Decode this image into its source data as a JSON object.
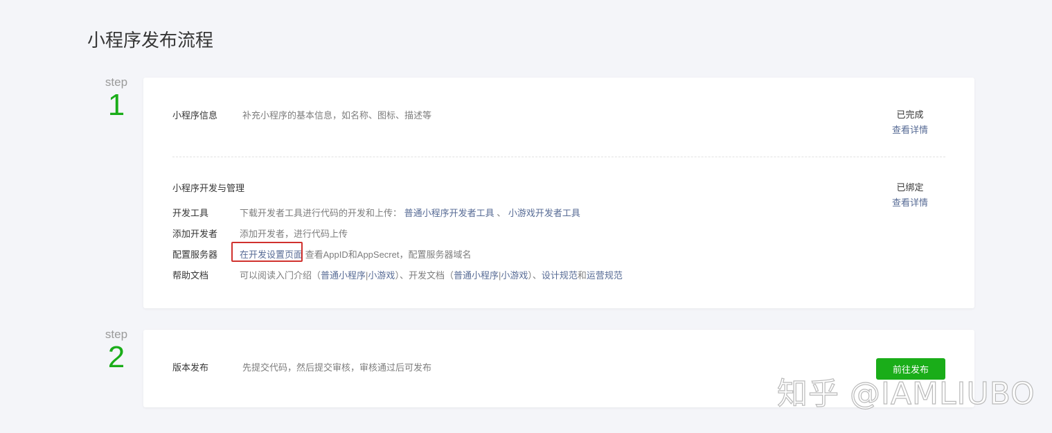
{
  "page": {
    "title": "小程序发布流程"
  },
  "steps": [
    {
      "word": "step",
      "number": "1"
    },
    {
      "word": "step",
      "number": "2"
    }
  ],
  "step1": {
    "info": {
      "label": "小程序信息",
      "desc": "补充小程序的基本信息，如名称、图标、描述等",
      "status": "已完成",
      "detail": "查看详情"
    },
    "dev": {
      "title": "小程序开发与管理",
      "status": "已绑定",
      "detail": "查看详情",
      "tools": {
        "label": "开发工具",
        "desc": "下载开发者工具进行代码的开发和上传：",
        "link1": "普通小程序开发者工具",
        "sep": "、",
        "link2": "小游戏开发者工具"
      },
      "add_dev": {
        "label": "添加开发者",
        "desc": "添加开发者，进行代码上传"
      },
      "server": {
        "label": "配置服务器",
        "link": "在开发设置页面",
        "desc": "查看AppID和AppSecret，配置服务器域名"
      },
      "docs": {
        "label": "帮助文档",
        "t1": "可以阅读入门介绍（",
        "l1": "普通小程序",
        "s1": "|",
        "l2": "小游戏",
        "t2": "）、开发文档（",
        "l3": "普通小程序",
        "s2": "|",
        "l4": "小游戏",
        "t3": "）、",
        "l5": "设计规范",
        "t4": "和",
        "l6": "运营规范"
      }
    }
  },
  "step2": {
    "label": "版本发布",
    "desc": "先提交代码，然后提交审核，审核通过后可发布",
    "button": "前往发布"
  },
  "watermark": "知乎 @IAMLIUBO",
  "colors": {
    "accent": "#1aad19",
    "link": "#576b95",
    "highlight": "#d0312d",
    "background": "#f4f5f9"
  }
}
